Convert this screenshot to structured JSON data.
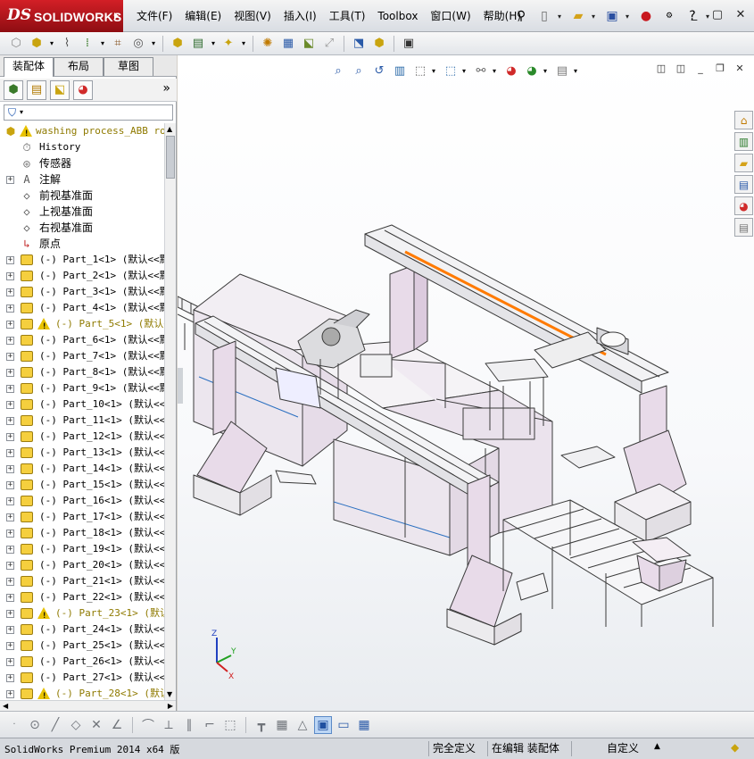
{
  "app": {
    "logo_ds": "DS",
    "logo_text": "SOLIDWORKS"
  },
  "menu": [
    {
      "label": "文件(F)"
    },
    {
      "label": "编辑(E)"
    },
    {
      "label": "视图(V)"
    },
    {
      "label": "插入(I)"
    },
    {
      "label": "工具(T)"
    },
    {
      "label": "Toolbox"
    },
    {
      "label": "窗口(W)"
    },
    {
      "label": "帮助(H)"
    }
  ],
  "title_tools": {
    "pin": "⚲",
    "new": "🗋",
    "open": "📂",
    "save": "💾",
    "rebuild": "🚦",
    "options": "?",
    "help": "?"
  },
  "window_controls": {
    "minimize": "—",
    "restore": "▢",
    "close": "✕"
  },
  "tabs": [
    {
      "label": "装配体",
      "active": true
    },
    {
      "label": "布局",
      "active": false
    },
    {
      "label": "草图",
      "active": false
    }
  ],
  "panel_more": "»",
  "tree": {
    "root": "washing process_ABB robo",
    "nodes": [
      {
        "label": "History",
        "icon": "history-icon",
        "expander": false,
        "cn": false
      },
      {
        "label": "传感器",
        "icon": "sensor-icon",
        "expander": false,
        "cn": true
      },
      {
        "label": "注解",
        "icon": "annotation-icon",
        "expander": true,
        "cn": true
      },
      {
        "label": "前视基准面",
        "icon": "plane-icon",
        "expander": false,
        "cn": true
      },
      {
        "label": "上视基准面",
        "icon": "plane-icon",
        "expander": false,
        "cn": true
      },
      {
        "label": "右视基准面",
        "icon": "plane-icon",
        "expander": false,
        "cn": true
      },
      {
        "label": "原点",
        "icon": "origin-icon",
        "expander": false,
        "cn": true
      }
    ],
    "parts": [
      {
        "label": "(-) Part_1<1> (默认<<默认",
        "warn": false
      },
      {
        "label": "(-) Part_2<1> (默认<<默",
        "warn": false
      },
      {
        "label": "(-) Part_3<1> (默认<<默",
        "warn": false
      },
      {
        "label": "(-) Part_4<1> (默认<<默",
        "warn": false
      },
      {
        "label": "(-) Part_5<1> (默认<",
        "warn": true
      },
      {
        "label": "(-) Part_6<1> (默认<<默",
        "warn": false
      },
      {
        "label": "(-) Part_7<1> (默认<<默",
        "warn": false
      },
      {
        "label": "(-) Part_8<1> (默认<<默",
        "warn": false
      },
      {
        "label": "(-) Part_9<1> (默认<<默",
        "warn": false
      },
      {
        "label": "(-) Part_10<1> (默认<<暑",
        "warn": false
      },
      {
        "label": "(-) Part_11<1> (默认<<暑",
        "warn": false
      },
      {
        "label": "(-) Part_12<1> (默认<<暑",
        "warn": false
      },
      {
        "label": "(-) Part_13<1> (默认<<暑",
        "warn": false
      },
      {
        "label": "(-) Part_14<1> (默认<<暑",
        "warn": false
      },
      {
        "label": "(-) Part_15<1> (默认<<暑",
        "warn": false
      },
      {
        "label": "(-) Part_16<1> (默认<<暑",
        "warn": false
      },
      {
        "label": "(-) Part_17<1> (默认<<暑",
        "warn": false
      },
      {
        "label": "(-) Part_18<1> (默认<<暑",
        "warn": false
      },
      {
        "label": "(-) Part_19<1> (默认<<暑",
        "warn": false
      },
      {
        "label": "(-) Part_20<1> (默认<<暑",
        "warn": false
      },
      {
        "label": "(-) Part_21<1> (默认<<暑",
        "warn": false
      },
      {
        "label": "(-) Part_22<1> (默认<<暑",
        "warn": false
      },
      {
        "label": "(-) Part_23<1> (默认",
        "warn": true
      },
      {
        "label": "(-) Part_24<1> (默认<<暑",
        "warn": false
      },
      {
        "label": "(-) Part_25<1> (默认<<暑",
        "warn": false
      },
      {
        "label": "(-) Part_26<1> (默认<<暑",
        "warn": false
      },
      {
        "label": "(-) Part_27<1> (默认<<暑",
        "warn": false
      },
      {
        "label": "(-) Part_28<1> (默认<",
        "warn": true
      }
    ]
  },
  "triad": {
    "x": "X",
    "y": "Y",
    "z": "Z"
  },
  "status": {
    "product": "SolidWorks Premium 2014 x64 版",
    "fully_defined": "完全定义",
    "editing": "在编辑 装配体",
    "custom": "自定义"
  },
  "colors": {
    "logo_red": "#c8181f",
    "tree_warning_text": "#8f7a00",
    "part_icon": "#f5cf3e",
    "model_panel": "#e8dbe9",
    "model_rail": "#ff7a00"
  }
}
